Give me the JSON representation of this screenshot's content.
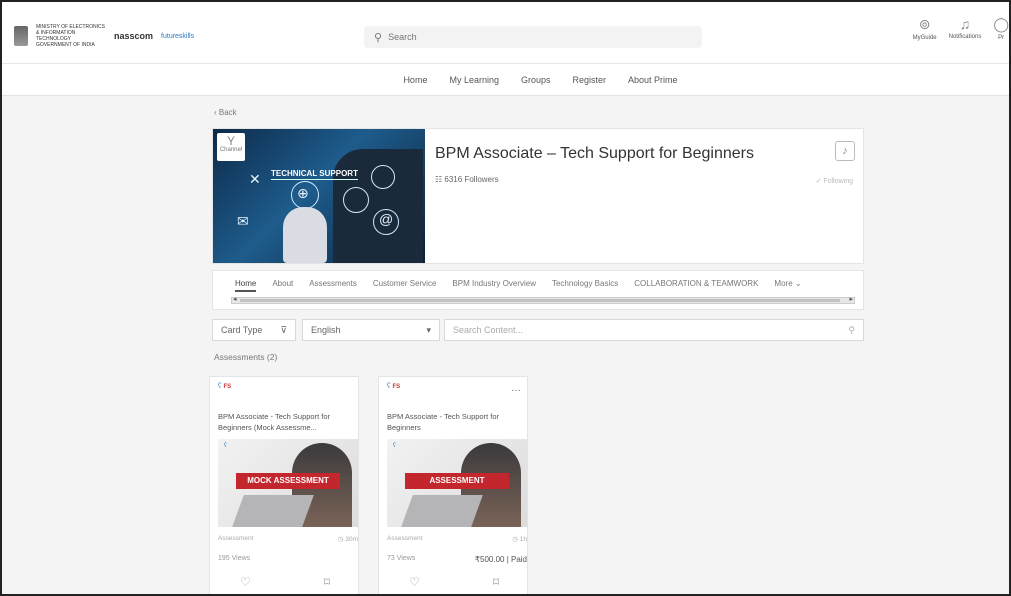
{
  "header": {
    "gov_text": "MINISTRY OF ELECTRONICS & INFORMATION TECHNOLOGY GOVERNMENT OF INDIA",
    "nasscom": "nasscom",
    "futureskills": "futureskills",
    "search_placeholder": "Search",
    "icons": [
      {
        "name": "myguide-icon",
        "label": "MyGuide"
      },
      {
        "name": "notifications-icon",
        "label": "Notifications"
      },
      {
        "name": "profile-icon",
        "label": "Pr"
      }
    ]
  },
  "nav": [
    "Home",
    "My Learning",
    "Groups",
    "Register",
    "About Prime"
  ],
  "back": "‹ Back",
  "channel": {
    "badge": "Channel",
    "banner_text": "TECHNICAL SUPPORT",
    "title": "BPM Associate – Tech Support for Beginners",
    "followers": "6316 Followers",
    "following": "✓ Following"
  },
  "tabs": [
    "Home",
    "About",
    "Assessments",
    "Customer Service",
    "BPM Industry Overview",
    "Technology Basics",
    "COLLABORATION & TEAMWORK",
    "More ⌄"
  ],
  "filters": {
    "card_type": "Card Type",
    "language": "English",
    "search_placeholder": "Search Content..."
  },
  "section_title": "Assessments (2)",
  "cards": [
    {
      "title": "BPM Associate - Tech Support for Beginners (Mock Assessme...",
      "banner": "MOCK ASSESSMENT",
      "type": "Assessment",
      "duration": "◷ 30m",
      "views": "195 Views",
      "price": ""
    },
    {
      "title": "BPM Associate - Tech Support for Beginners",
      "banner": "ASSESSMENT",
      "type": "Assessment",
      "duration": "◷ 1h",
      "views": "73 Views",
      "price": "₹500.00 | Paid"
    }
  ]
}
